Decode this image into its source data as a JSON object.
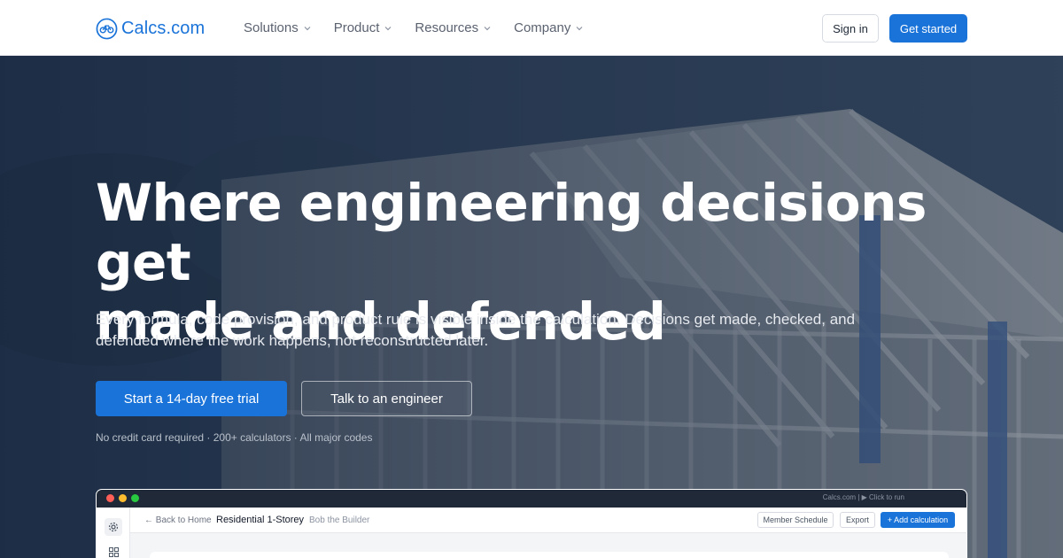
{
  "brand": {
    "name": "Calcs.com",
    "accent": "#1a73d9"
  },
  "nav": {
    "menu": [
      {
        "label": "Solutions"
      },
      {
        "label": "Product"
      },
      {
        "label": "Resources"
      },
      {
        "label": "Company"
      }
    ],
    "sign_in": "Sign in",
    "get_started": "Get started"
  },
  "hero": {
    "title_line1": "Where engineering decisions get",
    "title_line2": "made and defended",
    "subtitle": "Every formula, code provision, and product rule is visible inside the calculation. Decisions get made, checked, and defended where the work happens, not reconstructed later.",
    "cta_primary": "Start a 14-day free trial",
    "cta_secondary": "Talk to an engineer",
    "fineprint": "No credit card required · 200+ calculators · All major codes"
  },
  "app_preview": {
    "window_label": "Calcs.com  |  ▶ Click to run",
    "back": "← Back to Home",
    "project": "Residential 1-Storey",
    "owner": "Bob the Builder",
    "member_schedule": "Member Schedule",
    "export": "Export",
    "add_calculation": "+ Add calculation",
    "dot_colors": [
      "#ff5f57",
      "#febc2e",
      "#28c840"
    ]
  }
}
